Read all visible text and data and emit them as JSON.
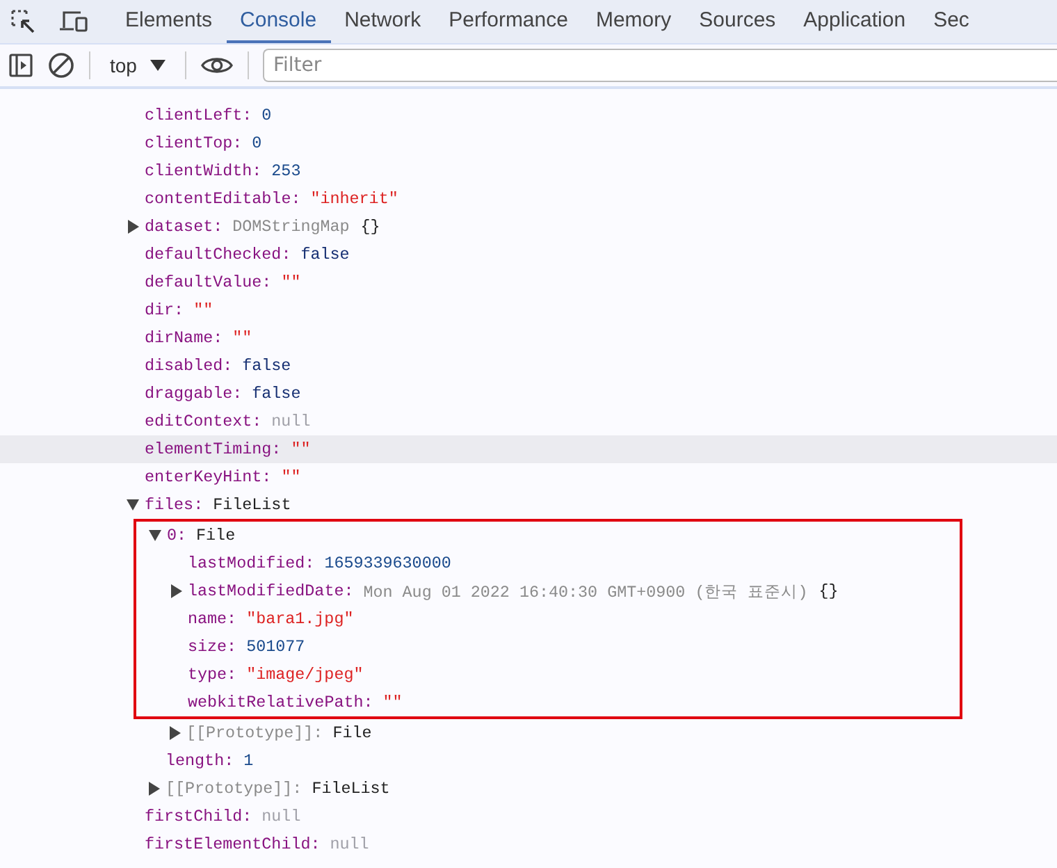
{
  "tabs": [
    {
      "label": "Elements",
      "selected": false
    },
    {
      "label": "Console",
      "selected": true
    },
    {
      "label": "Network",
      "selected": false
    },
    {
      "label": "Performance",
      "selected": false
    },
    {
      "label": "Memory",
      "selected": false
    },
    {
      "label": "Sources",
      "selected": false
    },
    {
      "label": "Application",
      "selected": false
    },
    {
      "label": "Sec",
      "selected": false
    }
  ],
  "toolbar": {
    "context": "top",
    "filter": {
      "placeholder": "Filter"
    }
  },
  "properties": [
    {
      "kind": "property",
      "key": "clientLeft:",
      "value": {
        "kind": "number",
        "text": "0"
      },
      "hovered": false,
      "boxed": false
    },
    {
      "kind": "property",
      "key": "clientTop:",
      "value": {
        "kind": "number",
        "text": "0"
      },
      "hovered": false,
      "boxed": false
    },
    {
      "kind": "property",
      "key": "clientWidth:",
      "value": {
        "kind": "number",
        "text": "253"
      },
      "hovered": false,
      "boxed": false
    },
    {
      "kind": "property",
      "key": "contentEditable:",
      "value": {
        "kind": "string",
        "text": "\"inherit\""
      },
      "hovered": false,
      "boxed": false
    },
    {
      "kind": "node",
      "expanded": false,
      "key": "dataset:",
      "value": {
        "kind": "preview",
        "text": "DOMStringMap"
      },
      "suffix": "{}",
      "hovered": false,
      "boxed": false
    },
    {
      "kind": "property",
      "key": "defaultChecked:",
      "value": {
        "kind": "boolean",
        "text": "false"
      },
      "hovered": false,
      "boxed": false
    },
    {
      "kind": "property",
      "key": "defaultValue:",
      "value": {
        "kind": "string",
        "text": "\"\""
      },
      "hovered": false,
      "boxed": false
    },
    {
      "kind": "property",
      "key": "dir:",
      "value": {
        "kind": "string",
        "text": "\"\""
      },
      "hovered": false,
      "boxed": false
    },
    {
      "kind": "property",
      "key": "dirName:",
      "value": {
        "kind": "string",
        "text": "\"\""
      },
      "hovered": false,
      "boxed": false
    },
    {
      "kind": "property",
      "key": "disabled:",
      "value": {
        "kind": "boolean",
        "text": "false"
      },
      "hovered": false,
      "boxed": false
    },
    {
      "kind": "property",
      "key": "draggable:",
      "value": {
        "kind": "boolean",
        "text": "false"
      },
      "hovered": false,
      "boxed": false
    },
    {
      "kind": "property",
      "key": "editContext:",
      "value": {
        "kind": "null",
        "text": "null"
      },
      "hovered": false,
      "boxed": false
    },
    {
      "kind": "property",
      "key": "elementTiming:",
      "value": {
        "kind": "string",
        "text": "\"\""
      },
      "hovered": true,
      "boxed": false
    },
    {
      "kind": "property",
      "key": "enterKeyHint:",
      "value": {
        "kind": "string",
        "text": "\"\""
      },
      "hovered": false,
      "boxed": false
    },
    {
      "kind": "node",
      "expanded": true,
      "key": "files:",
      "value": {
        "kind": "class",
        "text": "FileList"
      },
      "hovered": false,
      "boxed": false,
      "children": [
        {
          "kind": "node",
          "expanded": true,
          "key": "0:",
          "value": {
            "kind": "class",
            "text": "File"
          },
          "hovered": false,
          "boxed": true,
          "children": [
            {
              "kind": "property",
              "key": "lastModified:",
              "value": {
                "kind": "number",
                "text": "1659339630000"
              },
              "hovered": false,
              "boxed": true
            },
            {
              "kind": "node",
              "expanded": false,
              "key": "lastModifiedDate:",
              "value": {
                "kind": "preview",
                "text": "Mon Aug 01 2022 16:40:30 GMT+0900 (한국 표준시)"
              },
              "suffix": "{}",
              "hovered": false,
              "boxed": true
            },
            {
              "kind": "property",
              "key": "name:",
              "value": {
                "kind": "string",
                "text": "\"bara1.jpg\""
              },
              "hovered": false,
              "boxed": true
            },
            {
              "kind": "property",
              "key": "size:",
              "value": {
                "kind": "number",
                "text": "501077"
              },
              "hovered": false,
              "boxed": true
            },
            {
              "kind": "property",
              "key": "type:",
              "value": {
                "kind": "string",
                "text": "\"image/jpeg\""
              },
              "hovered": false,
              "boxed": true
            },
            {
              "kind": "property",
              "key": "webkitRelativePath:",
              "value": {
                "kind": "string",
                "text": "\"\""
              },
              "hovered": false,
              "boxed": true
            },
            {
              "kind": "internal-node",
              "expanded": false,
              "key": "[[Prototype]]:",
              "value": {
                "kind": "class",
                "text": "File"
              },
              "hovered": false,
              "boxed": false
            }
          ]
        },
        {
          "kind": "property",
          "key": "length:",
          "value": {
            "kind": "number",
            "text": "1"
          },
          "hovered": false,
          "boxed": false
        },
        {
          "kind": "internal-node",
          "expanded": false,
          "key": "[[Prototype]]:",
          "value": {
            "kind": "class",
            "text": "FileList"
          },
          "hovered": false,
          "boxed": false
        }
      ]
    },
    {
      "kind": "property",
      "key": "firstChild:",
      "value": {
        "kind": "null",
        "text": "null"
      },
      "hovered": false,
      "boxed": false
    },
    {
      "kind": "property",
      "key": "firstElementChild:",
      "value": {
        "kind": "null",
        "text": "null"
      },
      "hovered": false,
      "boxed": false
    }
  ]
}
